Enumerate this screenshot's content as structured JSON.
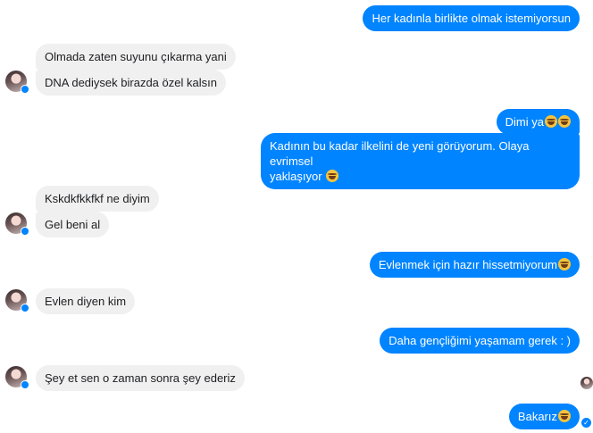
{
  "conversation": {
    "messages": [
      {
        "sender": "me",
        "text": "Her kadınla birlikte olmak istemiyorsun"
      },
      {
        "sender": "contact",
        "text": "Olmada zaten suyunu çıkarma yani"
      },
      {
        "sender": "contact",
        "text": "DNA dediysek birazda özel kalsın"
      },
      {
        "sender": "me",
        "text": "Dimi ya",
        "emoji": "laughing-tears-emoji x2"
      },
      {
        "sender": "me",
        "text_line1": "Kadının bu kadar ilkelini de yeni görüyorum. Olaya evrimsel",
        "text_line2": "yaklaşıyor",
        "emoji": "laughing-tears-emoji"
      },
      {
        "sender": "contact",
        "text": "Kskdkfkkfkf ne diyim"
      },
      {
        "sender": "contact",
        "text": "Gel beni al"
      },
      {
        "sender": "me",
        "text": "Evlenmek için hazır hissetmiyorum",
        "emoji": "laughing-tears-emoji"
      },
      {
        "sender": "contact",
        "text": "Evlen diyen kim"
      },
      {
        "sender": "me",
        "text": "Daha gençliğimi yaşamam gerek : )"
      },
      {
        "sender": "contact",
        "text": "Şey et sen o zaman sonra şey ederiz"
      },
      {
        "sender": "me",
        "text": "Bakarız",
        "emoji": "laughing-tears-emoji"
      }
    ]
  },
  "colors": {
    "outgoing_bubble": "#0084ff",
    "incoming_bubble": "#f1f0f0",
    "badge": "#0084ff"
  }
}
